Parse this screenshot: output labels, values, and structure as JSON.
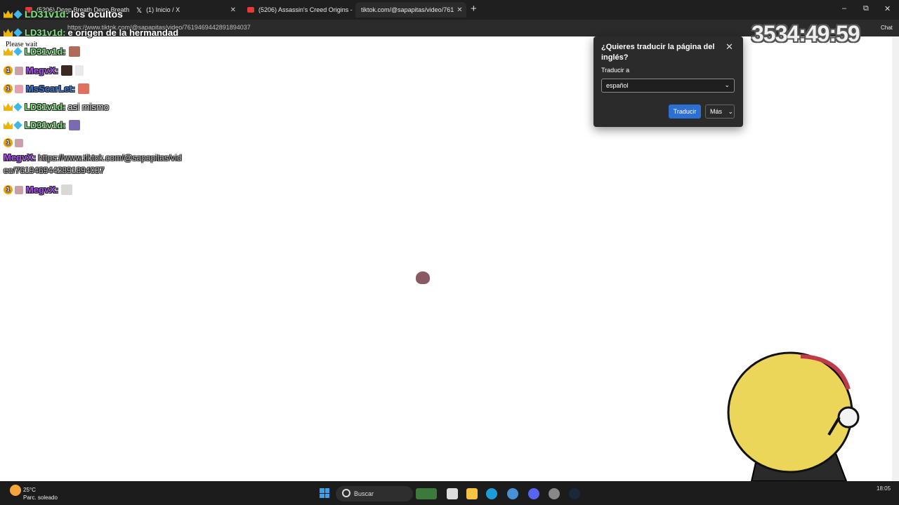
{
  "browser": {
    "tabs": [
      {
        "title": "(5206) Deep Breath Deep Breath",
        "icon_color": "#e53935",
        "active": false
      },
      {
        "title": "(1) Inicio / X",
        "icon_color": "#ffffff",
        "active": false
      },
      {
        "title": "(5206) Assassin's Creed Origins - T",
        "icon_color": "#e53935",
        "active": false
      },
      {
        "title": "tiktok.com/@sapapitas/video/761",
        "icon_color": "#2b2b2b",
        "active": true
      }
    ],
    "url": "https://www.tiktok.com/@sapapitas/video/7619469442891894037",
    "chat_label": "Chat",
    "window_controls": {
      "minimize": "–",
      "maximize": "⧉",
      "close": "✕"
    }
  },
  "page": {
    "status_text": "Please wait"
  },
  "chat": {
    "messages": [
      {
        "user": "LD31v1d",
        "badge": "crown",
        "text": "los ocultos"
      },
      {
        "user": "LD31v1d",
        "badge": "crown",
        "text": "e origen de la hermandad"
      },
      {
        "user": "LD31v1d",
        "badge": "crown",
        "text": ""
      },
      {
        "user": "MegvX",
        "badge": "1",
        "text": ""
      },
      {
        "user": "MsScarLet",
        "badge": "1",
        "text": ""
      },
      {
        "user": "LD31v1d",
        "badge": "crown",
        "text": "asi mismo"
      },
      {
        "user": "LD31v1d",
        "badge": "crown",
        "text": ""
      },
      {
        "user": "MegvX",
        "badge": "1",
        "text": "https://www.tiktok.com/@sapapitas/vid",
        "text_cont": "eo/7619469442891894037"
      },
      {
        "user": "MegvX",
        "badge": "1",
        "text": ""
      }
    ]
  },
  "overlay": {
    "timer": "3534:49:59"
  },
  "translate_popup": {
    "title": "¿Quieres traducir la página del inglés?",
    "translate_to_label": "Traducir a",
    "selected_language": "español",
    "translate_button": "Traducir",
    "more_button": "Más",
    "close": "✕"
  },
  "taskbar": {
    "temperature": "25°C",
    "weather": "Parc. soleado",
    "search_label": "Buscar",
    "clock": "18:05"
  },
  "colors": {
    "name_green": "#7ee07e",
    "name_purple": "#a84ef0",
    "name_blue": "#3a78d8",
    "translate_blue": "#2e6fd3"
  }
}
